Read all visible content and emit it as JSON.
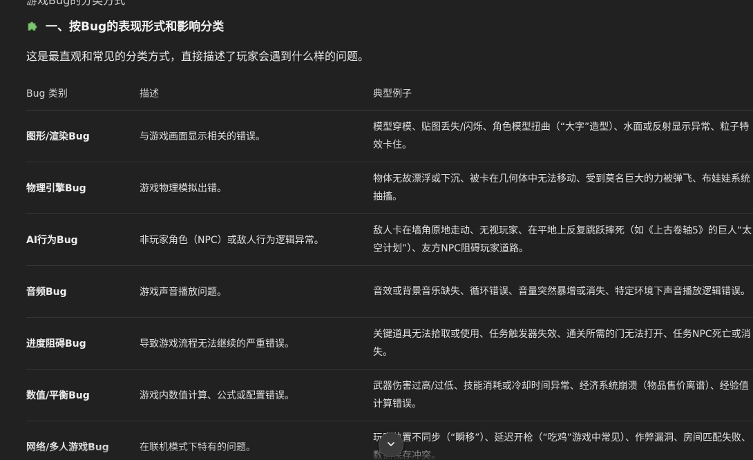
{
  "top_partial_text": "游戏Bug的分类方式",
  "section": {
    "icon": "puzzle-piece-icon",
    "title": "一、按Bug的表现形式和影响分类",
    "intro": "这是最直观和常见的分类方式，直接描述了玩家会遇到什么样的问题。"
  },
  "table": {
    "headers": [
      "Bug 类别",
      "描述",
      "典型例子"
    ],
    "rows": [
      {
        "category": "图形/渲染Bug",
        "description": "与游戏画面显示相关的错误。",
        "example": "模型穿模、贴图丢失/闪烁、角色模型扭曲（“大字”造型）、水面或反射显示异常、粒子特效卡住。"
      },
      {
        "category": "物理引擎Bug",
        "description": "游戏物理模拟出错。",
        "example": "物体无故漂浮或下沉、被卡在几何体中无法移动、受到莫名巨大的力被弹飞、布娃娃系统抽搐。"
      },
      {
        "category": "AI行为Bug",
        "description": "非玩家角色（NPC）或敌人行为逻辑异常。",
        "example": "敌人卡在墙角原地走动、无视玩家、在平地上反复跳跃摔死（如《上古卷轴5》的巨人“太空计划”）、友方NPC阻碍玩家道路。"
      },
      {
        "category": "音频Bug",
        "description": "游戏声音播放问题。",
        "example": "音效或背景音乐缺失、循环错误、音量突然暴增或消失、特定环境下声音播放逻辑错误。"
      },
      {
        "category": "进度阻碍Bug",
        "description": "导致游戏流程无法继续的严重错误。",
        "example": "关键道具无法拾取或使用、任务触发器失效、通关所需的门无法打开、任务NPC死亡或消失。"
      },
      {
        "category": "数值/平衡Bug",
        "description": "游戏内数值计算、公式或配置错误。",
        "example": "武器伤害过高/过低、技能消耗或冷却时间异常、经济系统崩溃（物品售价离谱）、经验值计算错误。"
      },
      {
        "category": "网络/多人游戏Bug",
        "description": "在联机模式下特有的问题。",
        "example": "玩家位置不同步（“瞬移”）、延迟开枪（“吃鸡”游戏中常见）、作弊漏洞、房间匹配失败、数据保存冲突。"
      }
    ]
  },
  "scroll_button": {
    "icon": "chevron-down-icon"
  }
}
